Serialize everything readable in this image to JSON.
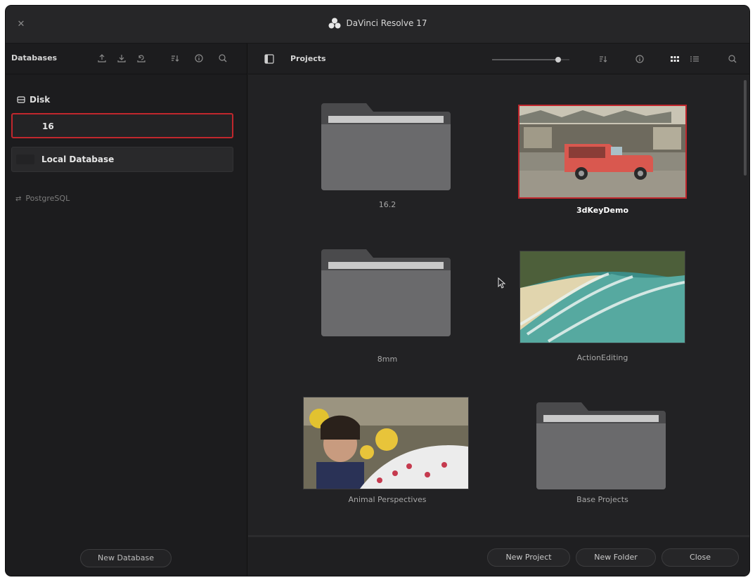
{
  "window": {
    "title": "DaVinci Resolve 17"
  },
  "left_panel": {
    "toolbar_label": "Databases",
    "toolbar_icons": [
      "upload-icon",
      "download-icon",
      "restore-icon",
      "sort-icon",
      "info-icon",
      "search-icon"
    ],
    "disk_section": "Disk",
    "databases": [
      {
        "label": "16",
        "selected": true
      },
      {
        "label": "Local Database",
        "selected": false
      }
    ],
    "postgres_section": "PostgreSQL",
    "new_database_label": "New Database"
  },
  "right_panel": {
    "toolbar_label": "Projects",
    "zoom_level": 0.85,
    "toolbar_icons": [
      "sidebar-toggle-icon",
      "sort-icon",
      "info-icon",
      "grid-view-icon",
      "list-view-icon",
      "search-icon"
    ],
    "projects": [
      {
        "label": "16.2",
        "kind": "folder",
        "selected": false
      },
      {
        "label": "3dKeyDemo",
        "kind": "project",
        "thumbnail": "red truck at market",
        "selected": true
      },
      {
        "label": "8mm",
        "kind": "folder",
        "selected": false
      },
      {
        "label": "ActionEditing",
        "kind": "project",
        "thumbnail": "beach with waves",
        "selected": false
      },
      {
        "label": "Animal Perspectives",
        "kind": "project",
        "thumbnail": "woman at flower market",
        "selected": false
      },
      {
        "label": "Base Projects",
        "kind": "folder",
        "selected": false
      }
    ],
    "buttons": {
      "new_project": "New Project",
      "new_folder": "New Folder",
      "close": "Close"
    }
  },
  "colors": {
    "accent_selection": "#c0272d",
    "background": "#1f1f21"
  }
}
